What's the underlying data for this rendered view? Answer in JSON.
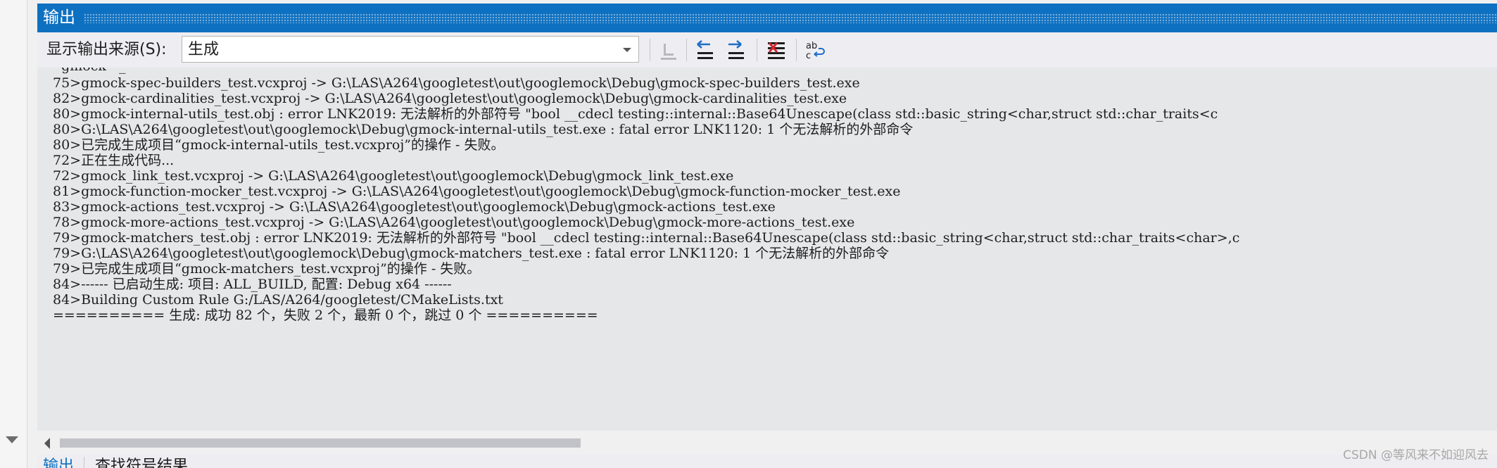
{
  "window": {
    "title": "输出"
  },
  "toolbar": {
    "source_label": "显示输出来源(S):",
    "source_value": "生成",
    "icons": [
      "go-to-line-icon",
      "previous-message-icon",
      "next-message-icon",
      "clear-all-icon",
      "word-wrap-icon"
    ]
  },
  "output_lines": [
    "75>gmock-spec-builders_test.vcxproj -> G:\\LAS\\A264\\googletest\\out\\googlemock\\Debug\\gmock-spec-builders_test.exe",
    "82>gmock-cardinalities_test.vcxproj -> G:\\LAS\\A264\\googletest\\out\\googlemock\\Debug\\gmock-cardinalities_test.exe",
    "80>gmock-internal-utils_test.obj : error LNK2019: 无法解析的外部符号 \"bool __cdecl testing::internal::Base64Unescape(class std::basic_string<char,struct std::char_traits<c",
    "80>G:\\LAS\\A264\\googletest\\out\\googlemock\\Debug\\gmock-internal-utils_test.exe : fatal error LNK1120: 1 个无法解析的外部命令",
    "80>已完成生成项目“gmock-internal-utils_test.vcxproj”的操作 - 失败。",
    "72>正在生成代码...",
    "72>gmock_link_test.vcxproj -> G:\\LAS\\A264\\googletest\\out\\googlemock\\Debug\\gmock_link_test.exe",
    "81>gmock-function-mocker_test.vcxproj -> G:\\LAS\\A264\\googletest\\out\\googlemock\\Debug\\gmock-function-mocker_test.exe",
    "83>gmock-actions_test.vcxproj -> G:\\LAS\\A264\\googletest\\out\\googlemock\\Debug\\gmock-actions_test.exe",
    "78>gmock-more-actions_test.vcxproj -> G:\\LAS\\A264\\googletest\\out\\googlemock\\Debug\\gmock-more-actions_test.exe",
    "79>gmock-matchers_test.obj : error LNK2019: 无法解析的外部符号 \"bool __cdecl testing::internal::Base64Unescape(class std::basic_string<char,struct std::char_traits<char>,c",
    "79>G:\\LAS\\A264\\googletest\\out\\googlemock\\Debug\\gmock-matchers_test.exe : fatal error LNK1120: 1 个无法解析的外部命令",
    "79>已完成生成项目“gmock-matchers_test.vcxproj”的操作 - 失败。",
    "84>------ 已启动生成: 项目: ALL_BUILD, 配置: Debug x64 ------",
    "84>Building Custom Rule G:/LAS/A264/googletest/CMakeLists.txt",
    "========== 生成: 成功 82 个，失败 2 个，最新 0 个，跳过 0 个 =========="
  ],
  "bottom_tabs": [
    "输出",
    "查找符号结果"
  ],
  "watermark": "CSDN @等风来不如迎风去"
}
